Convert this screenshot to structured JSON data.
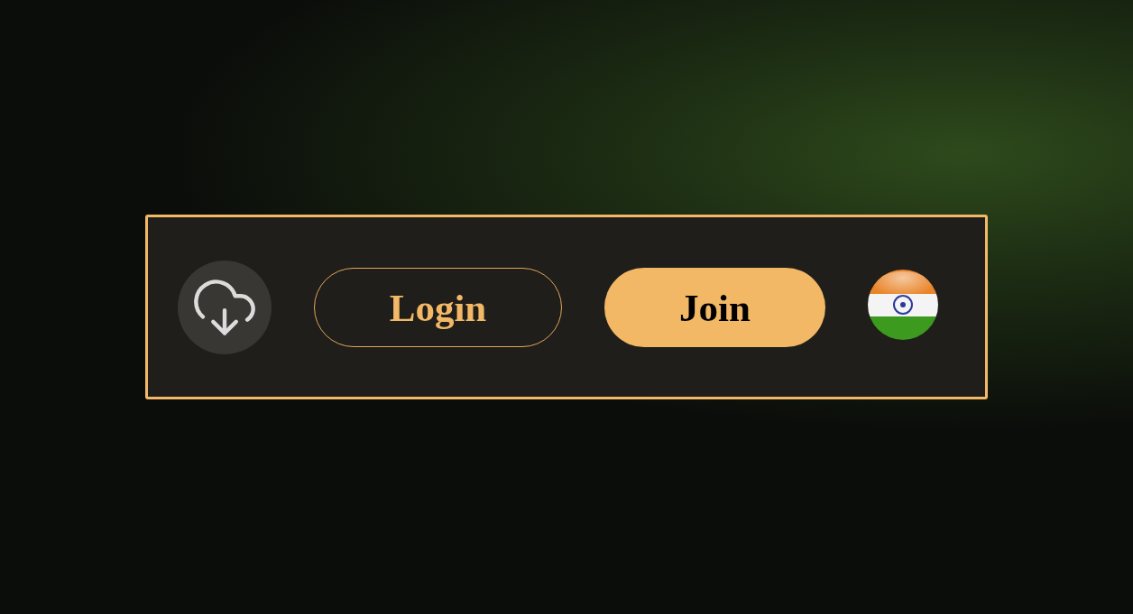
{
  "toolbar": {
    "download": {
      "kind": "download"
    },
    "buttons": [
      {
        "label": "Login",
        "kind": "outline"
      },
      {
        "label": "Join",
        "kind": "filled"
      }
    ],
    "language": {
      "kind": "flag"
    }
  }
}
